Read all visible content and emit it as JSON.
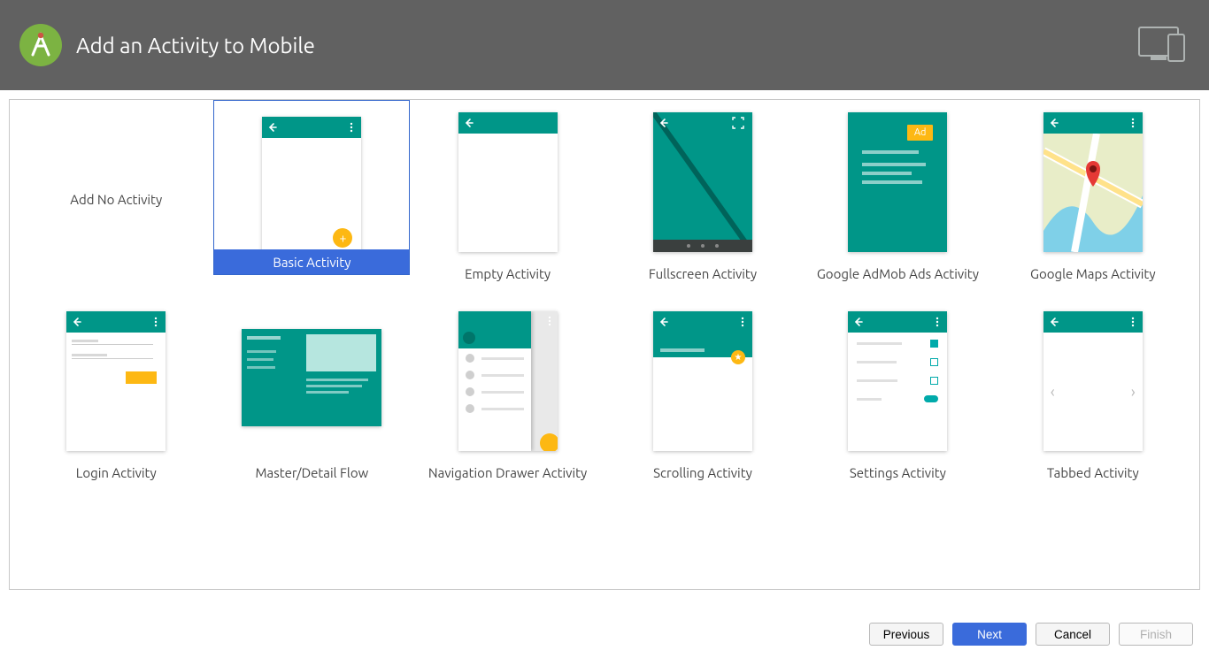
{
  "header": {
    "title": "Add an Activity to Mobile"
  },
  "templates": {
    "none": "Add No Activity",
    "basic": "Basic Activity",
    "empty": "Empty Activity",
    "fullscreen": "Fullscreen Activity",
    "admob": "Google AdMob Ads Activity",
    "maps": "Google Maps Activity",
    "login": "Login Activity",
    "masterdetail": "Master/Detail Flow",
    "navdrawer": "Navigation Drawer Activity",
    "scrolling": "Scrolling Activity",
    "settings": "Settings Activity",
    "tabbed": "Tabbed Activity"
  },
  "selected": "basic",
  "ad_label": "Ad",
  "buttons": {
    "previous": "Previous",
    "next": "Next",
    "cancel": "Cancel",
    "finish": "Finish"
  }
}
